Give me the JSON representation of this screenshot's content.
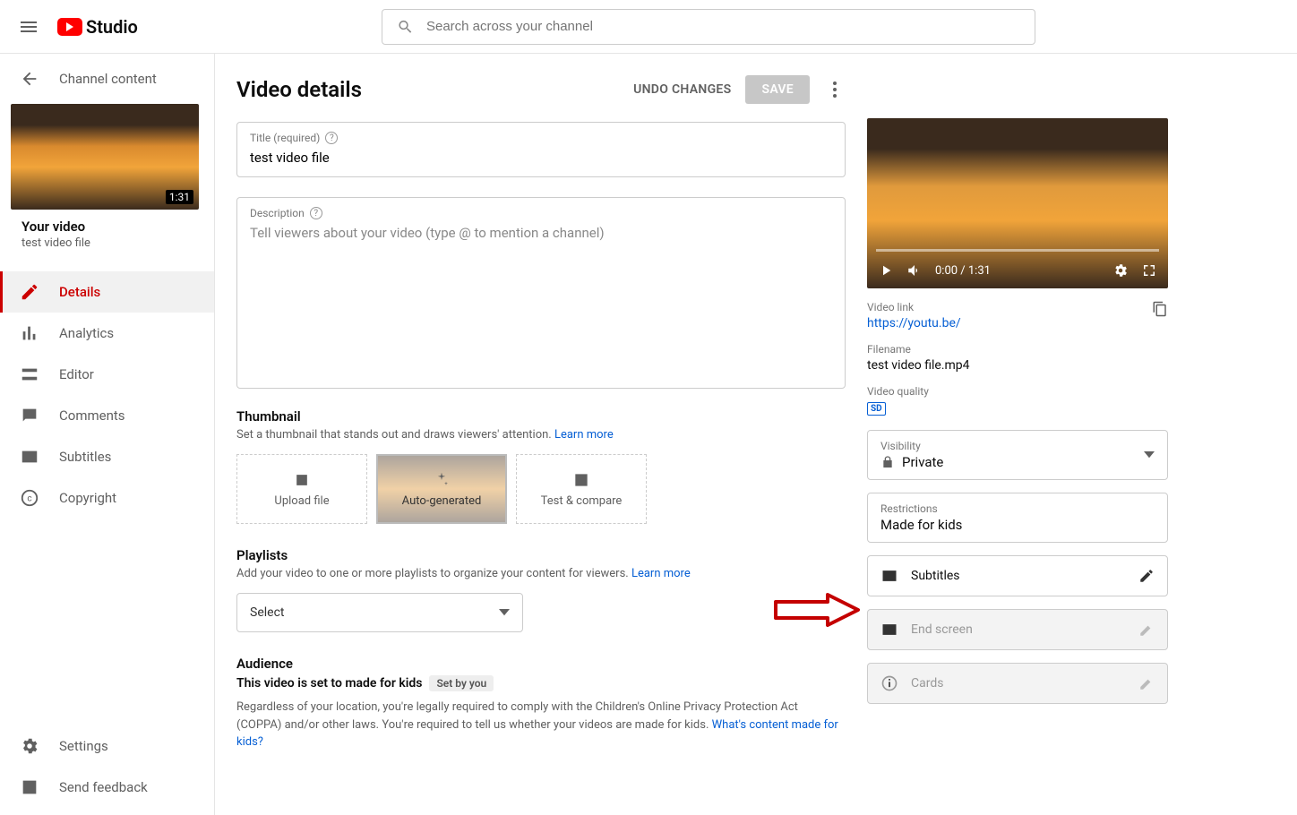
{
  "header": {
    "logo_text": "Studio",
    "search_placeholder": "Search across your channel"
  },
  "sidebar": {
    "back_label": "Channel content",
    "thumb_duration": "1:31",
    "your_video_heading": "Your video",
    "your_video_title": "test video file",
    "nav": [
      {
        "label": "Details",
        "icon": "pencil"
      },
      {
        "label": "Analytics",
        "icon": "analytics"
      },
      {
        "label": "Editor",
        "icon": "editor"
      },
      {
        "label": "Comments",
        "icon": "comments"
      },
      {
        "label": "Subtitles",
        "icon": "subtitles"
      },
      {
        "label": "Copyright",
        "icon": "copyright"
      }
    ],
    "footer_nav": [
      {
        "label": "Settings",
        "icon": "gear"
      },
      {
        "label": "Send feedback",
        "icon": "feedback"
      }
    ]
  },
  "page": {
    "title": "Video details",
    "undo": "UNDO CHANGES",
    "save": "SAVE",
    "title_field_label": "Title (required)",
    "title_value": "test video file",
    "desc_field_label": "Description",
    "desc_placeholder": "Tell viewers about your video (type @ to mention a channel)",
    "thumbnail_h": "Thumbnail",
    "thumbnail_sub": "Set a thumbnail that stands out and draws viewers' attention. ",
    "learn_more": "Learn more",
    "thumb_upload": "Upload file",
    "thumb_auto": "Auto-generated",
    "thumb_test": "Test & compare",
    "playlists_h": "Playlists",
    "playlists_sub": "Add your video to one or more playlists to organize your content for viewers. ",
    "playlists_select": "Select",
    "audience_h": "Audience",
    "audience_line": "This video is set to made for kids",
    "audience_chip": "Set by you",
    "audience_text1": "Regardless of your location, you're legally required to comply with the Children's Online Privacy Protection Act (COPPA) and/or other laws. You're required to tell us whether your videos are made for kids. ",
    "audience_link": "What's content made for kids?"
  },
  "preview": {
    "time": "0:00 / 1:31",
    "link_label": "Video link",
    "link_value": "https://youtu.be/",
    "filename_label": "Filename",
    "filename_value": "test video file.mp4",
    "quality_label": "Video quality",
    "quality_badge": "SD",
    "visibility_label": "Visibility",
    "visibility_value": "Private",
    "restrictions_label": "Restrictions",
    "restrictions_value": "Made for kids",
    "subtitles": "Subtitles",
    "end_screen": "End screen",
    "cards": "Cards"
  }
}
